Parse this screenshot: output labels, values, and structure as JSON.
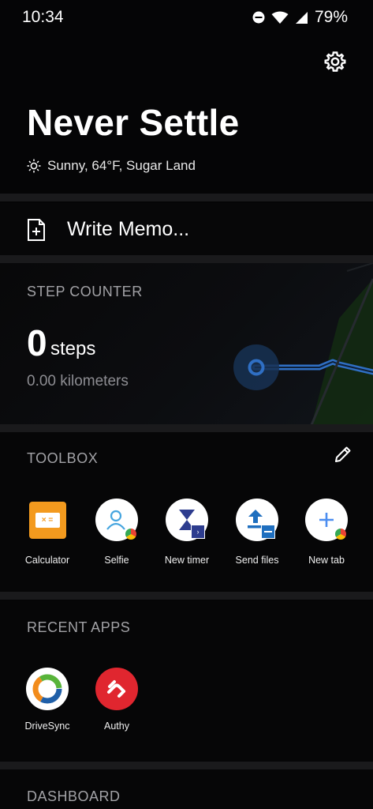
{
  "status_bar": {
    "time": "10:34",
    "battery_percent": "79%",
    "icons": [
      "do-not-disturb-icon",
      "wifi-icon",
      "cellular-signal-icon"
    ]
  },
  "header": {
    "title": "Never Settle",
    "weather": "Sunny, 64°F, Sugar Land",
    "weather_icon": "sun-icon"
  },
  "memo": {
    "label": "Write Memo..."
  },
  "step_counter": {
    "heading": "STEP COUNTER",
    "count": "0",
    "unit": "steps",
    "distance": "0.00 kilometers"
  },
  "toolbox": {
    "heading": "TOOLBOX",
    "tools": [
      {
        "label": "Calculator",
        "icon": "calculator-icon"
      },
      {
        "label": "Selfie",
        "icon": "selfie-icon"
      },
      {
        "label": "New timer",
        "icon": "hourglass-icon"
      },
      {
        "label": "Send files",
        "icon": "send-files-icon"
      },
      {
        "label": "New tab",
        "icon": "new-tab-icon"
      }
    ]
  },
  "recent_apps": {
    "heading": "RECENT APPS",
    "apps": [
      {
        "label": "DriveSync",
        "icon": "drivesync-icon"
      },
      {
        "label": "Authy",
        "icon": "authy-icon"
      }
    ]
  },
  "dashboard": {
    "heading": "DASHBOARD"
  },
  "colors": {
    "background": "#050506",
    "section_label": "#a2a2a6",
    "calculator": "#f39a1e",
    "authy": "#e0262f",
    "map_route": "#2f6fc4"
  }
}
